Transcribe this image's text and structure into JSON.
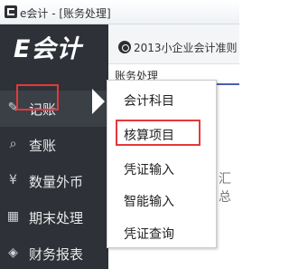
{
  "window": {
    "title": "e会计 - [账务处理]"
  },
  "sidebar": {
    "logo": "E会计",
    "items": [
      {
        "label": "记账",
        "icon": "ledger-edit-icon",
        "active": true
      },
      {
        "label": "查账",
        "icon": "search-document-icon"
      },
      {
        "label": "数量外币",
        "icon": "currency-icon"
      },
      {
        "label": "期末处理",
        "icon": "calendar-icon"
      },
      {
        "label": "财务报表",
        "icon": "report-icon"
      }
    ]
  },
  "content": {
    "accounting_standard": "2013小企业会计准则",
    "tab_label": "账务处理",
    "background_text": "汇总"
  },
  "menu": {
    "items": [
      {
        "label": "会计科目"
      },
      {
        "label": "核算项目",
        "highlighted": true
      },
      {
        "label": "凭证输入"
      },
      {
        "label": "智能输入"
      },
      {
        "label": "凭证查询"
      }
    ]
  },
  "colors": {
    "sidebar_bg": "#2e3137",
    "highlight_red": "#e5383b",
    "tab_underline": "#4a5fae"
  }
}
